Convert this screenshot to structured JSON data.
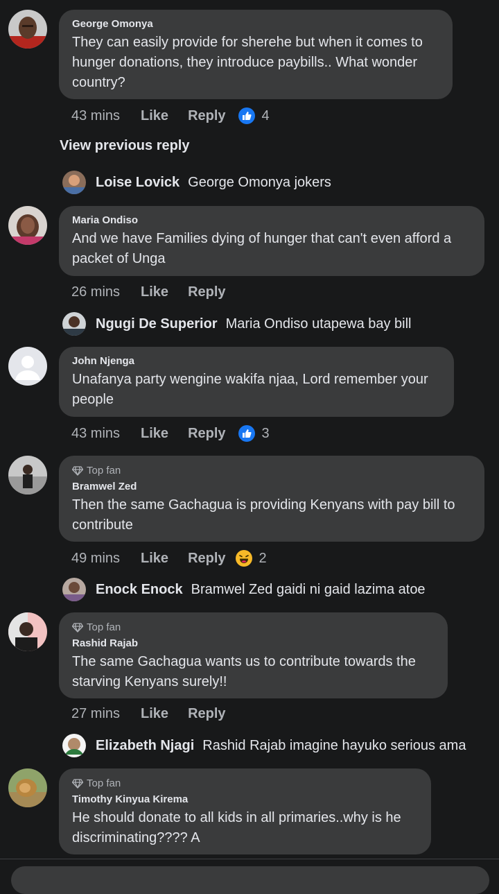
{
  "comments": [
    {
      "author": "George Omonya",
      "text": "They can easily provide for sherehe but when it comes to hunger donations, they introduce paybills.. What wonder country?",
      "time": "43 mins",
      "like": "Like",
      "reply": "Reply",
      "reaction_count": "4",
      "reaction_type": "like"
    },
    {
      "author": "Maria Ondiso",
      "text": "And we have Families dying  of hunger that can't even afford a packet of Unga",
      "time": "26 mins",
      "like": "Like",
      "reply": "Reply"
    },
    {
      "author": "John Njenga",
      "text": "Unafanya party wengine wakifa njaa, Lord remember your people",
      "time": "43 mins",
      "like": "Like",
      "reply": "Reply",
      "reaction_count": "3",
      "reaction_type": "like"
    },
    {
      "badge": "Top fan",
      "author": "Bramwel Zed",
      "text": "Then the same Gachagua is providing Kenyans with pay bill to contribute",
      "time": "49 mins",
      "like": "Like",
      "reply": "Reply",
      "reaction_count": "2",
      "reaction_type": "haha"
    },
    {
      "badge": "Top fan",
      "author": "Rashid Rajab",
      "text": "The same Gachagua wants us to contribute towards the starving Kenyans surely!!",
      "time": "27 mins",
      "like": "Like",
      "reply": "Reply"
    },
    {
      "badge": "Top fan",
      "author": "Timothy Kinyua Kirema",
      "text": "He should donate to all kids in all primaries..why is he discriminating???? A"
    }
  ],
  "view_previous_reply": "View previous reply",
  "replies": [
    {
      "author": "Loise Lovick",
      "text": "George Omonya jokers"
    },
    {
      "author": "Ngugi De Superior",
      "text": "Maria Ondiso utapewa bay bill"
    },
    {
      "author": "Enock Enock",
      "text": "Bramwel Zed gaidi ni gaid lazima atoe"
    },
    {
      "author": "Elizabeth Njagi",
      "text": "Rashid Rajab imagine hayuko serious ama"
    }
  ],
  "colors": {
    "background": "#18191a",
    "bubble": "#3a3b3c",
    "like_blue": "#1877f2",
    "secondary_text": "#b0b3b8"
  }
}
